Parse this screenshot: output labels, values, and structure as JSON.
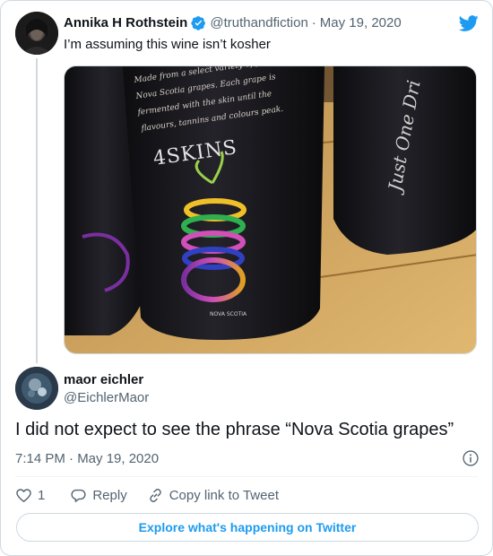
{
  "quoted_tweet": {
    "author_name": "Annika H Rothstein",
    "handle": "@truthandfiction",
    "separator": "·",
    "date": "May 19, 2020",
    "text": "I’m assuming this wine isn’t kosher",
    "photo": {
      "bottle_label_text": "Made from a select variety of fo Nova Scotia grapes. Each grape is fermented with the skin until the flavours, tannins and colours peak.",
      "brand": "4SKINS",
      "region_label": "NOVA SCOTIA",
      "second_bottle_script": "Just One Dri"
    }
  },
  "main_tweet": {
    "author_name": "maor eichler",
    "handle": "@EichlerMaor",
    "text": "I did not expect to see the phrase “Nova Scotia grapes”",
    "timestamp": "7:14 PM · May 19, 2020"
  },
  "actions": {
    "like_count": "1",
    "reply_label": "Reply",
    "copy_link_label": "Copy link to Tweet"
  },
  "explore_label": "Explore what's happening on Twitter",
  "colors": {
    "twitter_blue": "#1d9bf0",
    "text_primary": "#0f1419",
    "text_secondary": "#536471",
    "border": "#cfd9de"
  },
  "icons": {
    "brand": "twitter-bird-icon",
    "verified": "verified-badge-icon",
    "info": "info-icon",
    "like": "heart-icon",
    "reply": "reply-bubble-icon",
    "copy": "link-icon"
  }
}
